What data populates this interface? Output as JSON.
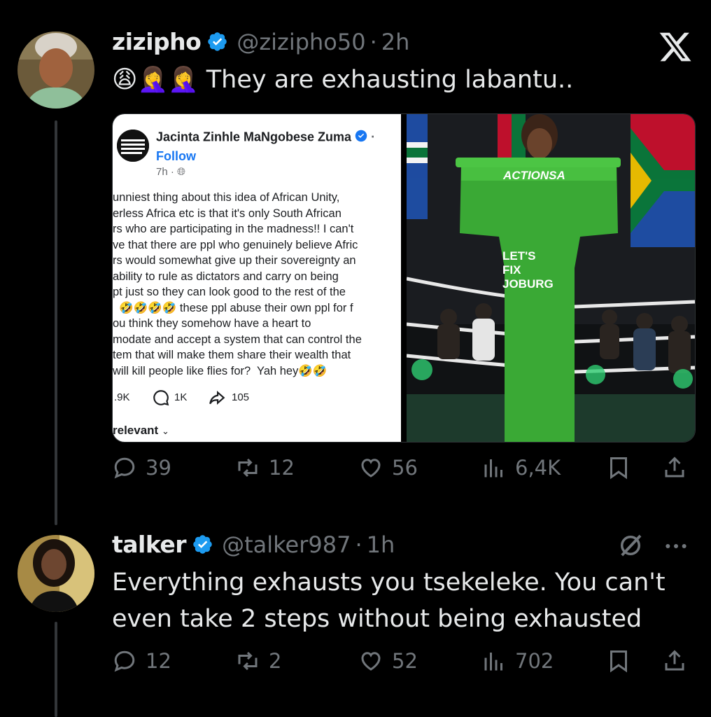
{
  "tweet1": {
    "name": "zizipho",
    "handle": "@zizipho50",
    "dot": "·",
    "time": "2h",
    "text": "😩🤦‍♀️🤦‍♀️ They are exhausting labantu..",
    "replies": "39",
    "reposts": "12",
    "likes": "56",
    "views": "6,4K"
  },
  "embedded_fb": {
    "author": "Jacinta Zinhle MaNgobese Zuma",
    "follow": "Follow",
    "time": "7h ·",
    "body": "unniest thing about this idea of African Unity,\nerless Africa etc is that it's only South African\nrs who are participating in the madness!! I can't\nve that there are ppl who genuinely believe Afric\nrs would somewhat give up their sovereignty an\nability to rule as dictators and carry on being\npt just so they can look good to the rest of the\n  🤣🤣🤣🤣 these ppl abuse their own ppl for f\nou think they somehow have a heart to\nmodate and accept a system that can control the\ntem that will make them share their wealth that\nwill kill people like flies for?  Yah hey🤣🤣",
    "likes": ".9K",
    "comments": "1K",
    "shares": "105",
    "relevant": "relevant"
  },
  "photo": {
    "podium_brand": "ACTIONSA",
    "podium_line1": "LET'S",
    "podium_line2": "FIX",
    "podium_line3": "JOBURG"
  },
  "tweet2": {
    "name": "talker",
    "handle": "@talker987",
    "dot": "·",
    "time": "1h",
    "text_line1": "Everything exhausts you tsekeleke. You can't",
    "text_line2": "even take 2 steps without being exhausted",
    "replies": "12",
    "reposts": "2",
    "likes": "52",
    "views": "702"
  },
  "colors": {
    "background": "#000000",
    "text": "#e7e9ea",
    "muted": "#71767b",
    "verified": "#1d9bf0",
    "actionsa_green": "#3aa935"
  }
}
